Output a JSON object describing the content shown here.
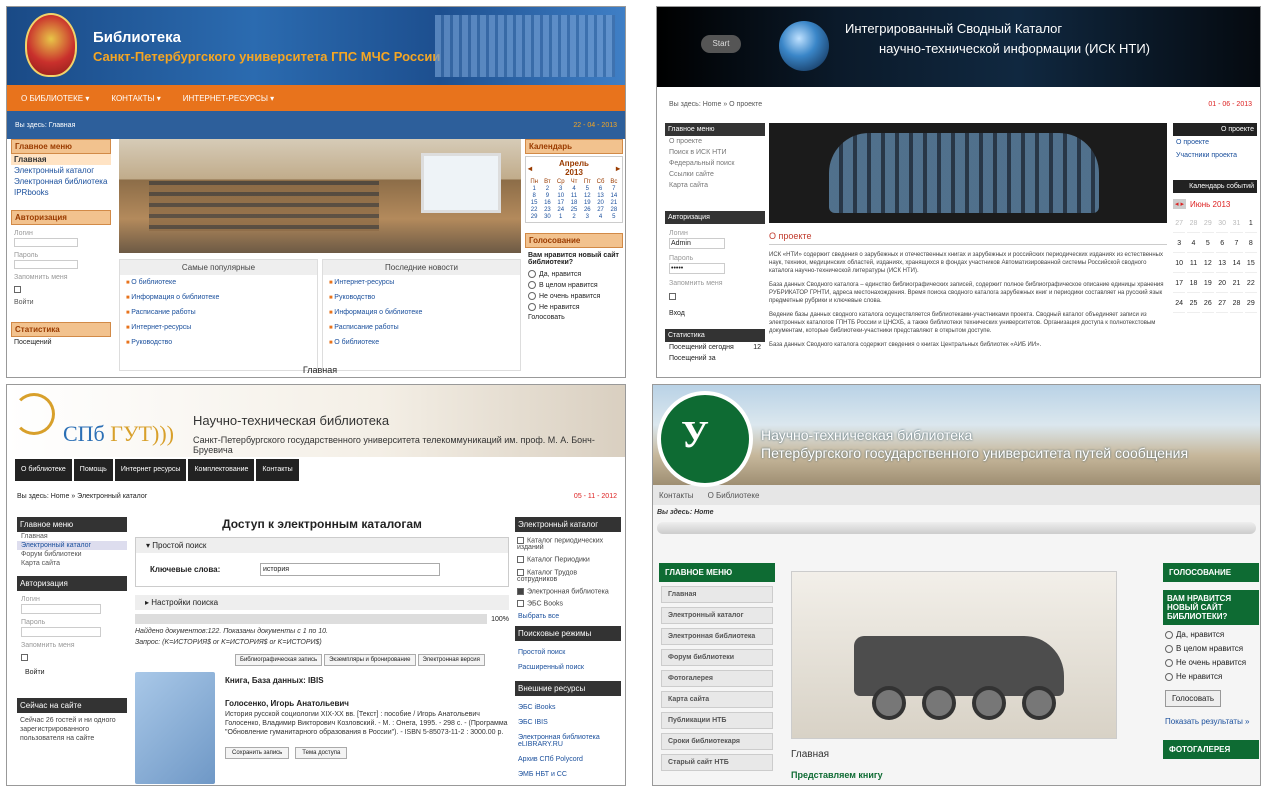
{
  "p1": {
    "title": "Библиотека",
    "subtitle": "Санкт-Петербургского университета ГПС МЧС России",
    "nav": [
      "О БИБЛИОТЕКЕ ▾",
      "КОНТАКТЫ ▾",
      "ИНТЕРНЕТ-РЕСУРСЫ ▾"
    ],
    "crumb": "Вы здесь: Главная",
    "date": "22 - 04 - 2013",
    "menu_title": "Главное меню",
    "menu": [
      "Главная",
      "Электронный каталог",
      "Электронная библиотека",
      "IPRbooks"
    ],
    "auth_title": "Авторизация",
    "auth": {
      "login": "Логин",
      "password": "Пароль",
      "remember": "Запомнить меня",
      "button": "Войти"
    },
    "stats_title": "Статистика",
    "stats_row": "Посещений",
    "col1_title": "Самые популярные",
    "col1": [
      "О библиотеке",
      "Информация о библиотеке",
      "Расписание работы",
      "Интернет-ресурсы",
      "Руководство"
    ],
    "col2_title": "Последние новости",
    "col2": [
      "Интернет-ресурсы",
      "Руководство",
      "Информация о библиотеке",
      "Расписание работы",
      "О библиотеке"
    ],
    "footer": "Главная",
    "cal_title": "Календарь",
    "cal_month": "Апрель",
    "cal_year": "2013",
    "cal_head": [
      "Пн",
      "Вт",
      "Ср",
      "Чт",
      "Пт",
      "Сб",
      "Вс"
    ],
    "cal_days": [
      "1",
      "2",
      "3",
      "4",
      "5",
      "6",
      "7",
      "8",
      "9",
      "10",
      "11",
      "12",
      "13",
      "14",
      "15",
      "16",
      "17",
      "18",
      "19",
      "20",
      "21",
      "22",
      "23",
      "24",
      "25",
      "26",
      "27",
      "28",
      "29",
      "30",
      "1",
      "2",
      "3",
      "4",
      "5"
    ],
    "poll_title": "Голосование",
    "poll_q": "Вам нравится новый сайт библиотеки?",
    "poll_opts": [
      "Да, нравится",
      "В целом нравится",
      "Не очень нравится",
      "Не нравится"
    ],
    "poll_btn": "Голосовать"
  },
  "p2": {
    "start": "Start",
    "title1": "Интегрированный Сводный Каталог",
    "title2": "научно-технической информации (ИСК НТИ)",
    "crumb": "Вы здесь: Home » О проекте",
    "date": "01 - 06 - 2013",
    "menu_title": "Главное меню",
    "menu": [
      "О проекте",
      "Поиск в ИСК НТИ",
      "Федеральный поиск",
      "Ссылки сайте",
      "Карта сайта"
    ],
    "auth_title": "Авторизация",
    "auth": {
      "login_label": "Логин",
      "login_val": "Admin",
      "pass_label": "Пароль",
      "pass_val": "•••••",
      "remember": "Запомнить меня",
      "button": "Вход"
    },
    "stats_title": "Статистика",
    "stats": [
      {
        "k": "Посещений сегодня",
        "v": "12"
      },
      {
        "k": "Посещений за",
        "v": ""
      }
    ],
    "article_title": "О проекте",
    "article_p1": "ИСК «НТИ» содержит сведения о зарубежных и отечественных книгах и зарубежных и российских периодических изданиях из естественных наук, техники, медицинских областей, изданиях, хранящихся в фондах участников Автоматизированной системы Российской сводного каталога научно-технической литературы (ИСК НТИ).",
    "article_p2": "База данных Сводного каталога – единство библиографических записей, содержит полное библиографическое описание единицы хранения РУБРИКАТОР ГРНТИ, адреса местонахождения. Время поиска сводного каталога зарубежных книг и периодики составляет на русский язык предметные рубрики и ключевые слова.",
    "article_p3": "Ведение базы данных сводного каталога осуществляется библиотеками-участниками проекта. Сводный каталог объединяет записи из электронных каталогов ГПНТБ России и ЦНСХБ, а также библиотеки технических университетов. Организация доступа к полнотекстовым документам, которые библиотеки-участники представляют в открытом доступе.",
    "article_p4": "База данных Сводного каталога содержит сведения о книгах Центральных библиотек «АИБ ИИ».",
    "tab_label": "О проекте",
    "rlinks": [
      "О проекте",
      "Участники проекта"
    ],
    "cal_title": "Календарь событий",
    "cal_month": "Июнь 2013",
    "cal_days": [
      "27",
      "28",
      "29",
      "30",
      "31",
      "1",
      "3",
      "4",
      "5",
      "6",
      "7",
      "8",
      "10",
      "11",
      "12",
      "13",
      "14",
      "15",
      "17",
      "18",
      "19",
      "20",
      "21",
      "22",
      "24",
      "25",
      "26",
      "27",
      "28",
      "29"
    ],
    "cal_muted": [
      0,
      1,
      2,
      3,
      4
    ]
  },
  "p3": {
    "spb": "СПб ",
    "gut": "ГУТ",
    "paren": ")))",
    "title": "Научно-техническая библиотека",
    "subtitle": "Санкт-Петербургского государственного университета телекоммуникаций им. проф. М. А. Бонч-Бруевича",
    "nav": [
      "О библиотеке",
      "Помощь",
      "Интернет ресурсы",
      "Комплектование",
      "Контакты"
    ],
    "crumb": "Вы здесь: Home » Электронный каталог",
    "date": "05 - 11 - 2012",
    "menu_title": "Главное меню",
    "menu": [
      "Главная",
      "Электронный каталог",
      "Форум библиотеки",
      "Карта сайта"
    ],
    "auth_title": "Авторизация",
    "auth": {
      "login": "Логин",
      "password": "Пароль",
      "remember": "Запомнить меня",
      "button": "Войти"
    },
    "online_title": "Сейчас на сайте",
    "online_text": "Сейчас 26 гостей и ни одного зарегистрированного пользователя на сайте",
    "page_title": "Доступ к электронным каталогам",
    "simple": "▾  Простой поиск",
    "kw_label": "Ключевые слова:",
    "kw_value": "история",
    "adv": "▸  Настройки поиска",
    "pct": "100%",
    "found1": "Найдено документов:122. Показаны документы с 1 по 10.",
    "found2": "Запрос: (K=ИСТОРИЯ$ or K=ИСТОРИЯ$ or K=ИСТОРИ$)",
    "tabs": [
      "Библиографическая запись",
      "Экземпляры и бронирование",
      "Электронная версия"
    ],
    "book_type": "Книга, База данных: IBIS",
    "author": "Голосенко, Игорь Анатольевич",
    "desc": "История русской социологии XIX-XX вв. [Текст] : пособие / Игорь Анатольевич Голосенко, Владимир Викторович Козловский. - М. : Онега, 1995. - 298 с. - (Программа \"Обновление гуманитарного образования в России\"). - ISBN 5-85073-11-2 : 3000.00 р.",
    "btns": [
      "Сохранить запись",
      "Тема доступа"
    ],
    "cat_title": "Электронный каталог",
    "cats": [
      "Каталог периодических изданий",
      "Каталог Периодики",
      "Каталог Трудов сотрудников",
      "Электронная библиотека",
      "ЭБС Books"
    ],
    "cat_checked": [
      false,
      false,
      false,
      true,
      false
    ],
    "select_all": "Выбрать все",
    "modes_title": "Поисковые режимы",
    "modes": [
      "Простой поиск",
      "Расширенный поиск"
    ],
    "ext_title": "Внешние ресурсы",
    "ext": [
      "ЭБС iBooks",
      "ЭБС IBIS",
      "Электронная библиотека eLIBRARY.RU",
      "Архив СПб Polycord",
      "ЭМБ НБТ и СС"
    ]
  },
  "p4": {
    "title1": "Научно-техническая библиотека",
    "title2": "Петербургского государственного университета путей сообщения",
    "nav": [
      "Контакты",
      "О Библиотеке"
    ],
    "crumb": "Вы здесь: Home",
    "menu_title": "ГЛАВНОЕ МЕНЮ",
    "menu": [
      "Главная",
      "Электронный каталог",
      "Электронная библиотека",
      "Форум библиотеки",
      "Фотогалерея",
      "Карта сайта",
      "Публикации НТБ",
      "Сроки библиотекаря",
      "Старый сайт НТБ"
    ],
    "main_h": "Главная",
    "main_sub": "Представляем книгу",
    "vote_title": "ГОЛОСОВАНИЕ",
    "vote_q": "ВАМ НРАВИТСЯ НОВЫЙ САЙТ БИБЛИОТЕКИ?",
    "vote_opts": [
      "Да, нравится",
      "В целом нравится",
      "Не очень нравится",
      "Не нравится"
    ],
    "vote_btn": "Голосовать",
    "results": "Показать результаты »",
    "gallery": "ФОТОГАЛЕРЕЯ",
    "colors": {
      "green": "#0e6b33",
      "orange": "#e8731c",
      "blue": "#1a4f9c"
    }
  }
}
